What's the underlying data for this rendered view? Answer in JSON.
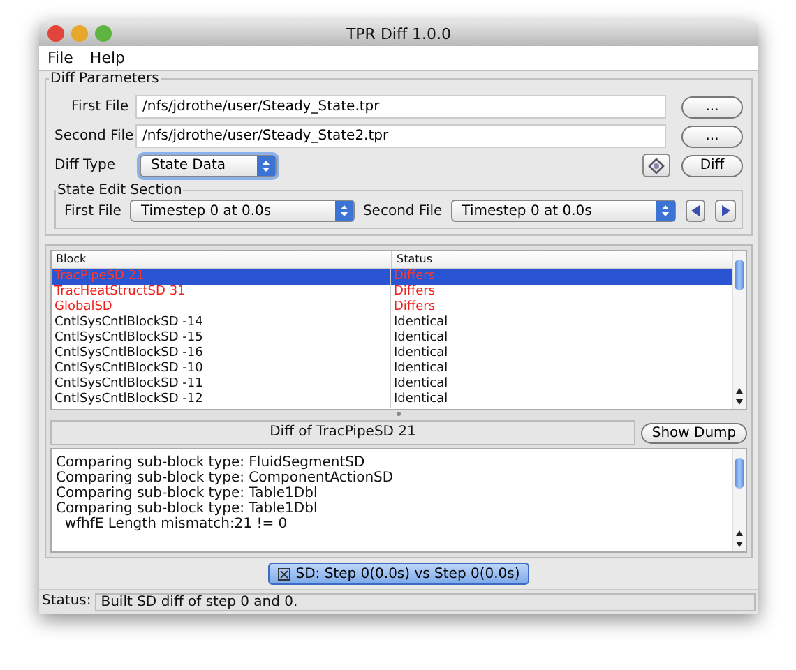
{
  "window": {
    "title": "TPR Diff 1.0.0"
  },
  "menu": [
    "File",
    "Help"
  ],
  "diff_parameters": {
    "title": "Diff Parameters",
    "first_file": {
      "label": "First File",
      "value": "/nfs/jdrothe/user/Steady_State.tpr",
      "button": "..."
    },
    "second_file": {
      "label": "Second File",
      "value": "/nfs/jdrothe/user/Steady_State2.tpr",
      "button": "..."
    },
    "diff_type": {
      "label": "Diff Type",
      "value": "State Data"
    },
    "diff_button": "Diff"
  },
  "state_edit": {
    "title": "State Edit Section",
    "first_label": "First File",
    "first_value": "Timestep 0 at 0.0s",
    "second_label": "Second File",
    "second_value": "Timestep 0 at 0.0s"
  },
  "table": {
    "columns": [
      "Block",
      "Status"
    ],
    "rows": [
      {
        "block": "TracPipeSD 21",
        "status": "Differs",
        "kind": "differs",
        "selected": true
      },
      {
        "block": "TracHeatStructSD 31",
        "status": "Differs",
        "kind": "differs",
        "selected": false
      },
      {
        "block": "GlobalSD",
        "status": "Differs",
        "kind": "differs",
        "selected": false
      },
      {
        "block": "CntlSysCntlBlockSD -14",
        "status": "Identical",
        "kind": "identical",
        "selected": false
      },
      {
        "block": "CntlSysCntlBlockSD -15",
        "status": "Identical",
        "kind": "identical",
        "selected": false
      },
      {
        "block": "CntlSysCntlBlockSD -16",
        "status": "Identical",
        "kind": "identical",
        "selected": false
      },
      {
        "block": "CntlSysCntlBlockSD -10",
        "status": "Identical",
        "kind": "identical",
        "selected": false
      },
      {
        "block": "CntlSysCntlBlockSD -11",
        "status": "Identical",
        "kind": "identical",
        "selected": false
      },
      {
        "block": "CntlSysCntlBlockSD -12",
        "status": "Identical",
        "kind": "identical",
        "selected": false
      }
    ]
  },
  "diff_title": "Diff of TracPipeSD 21",
  "show_dump": "Show Dump",
  "log": [
    "Comparing sub-block type: FluidSegmentSD",
    "Comparing sub-block type: ComponentActionSD",
    "Comparing sub-block type: Table1Dbl",
    "Comparing sub-block type: Table1Dbl",
    "  wfhfE Length mismatch:21 != 0"
  ],
  "tabs": [
    {
      "label": "SD: Step 0(0.0s) vs Step 0(0.0s)",
      "selected": true
    }
  ],
  "status_bar": {
    "label": "Status:",
    "text": "Built SD diff of step 0 and 0."
  }
}
